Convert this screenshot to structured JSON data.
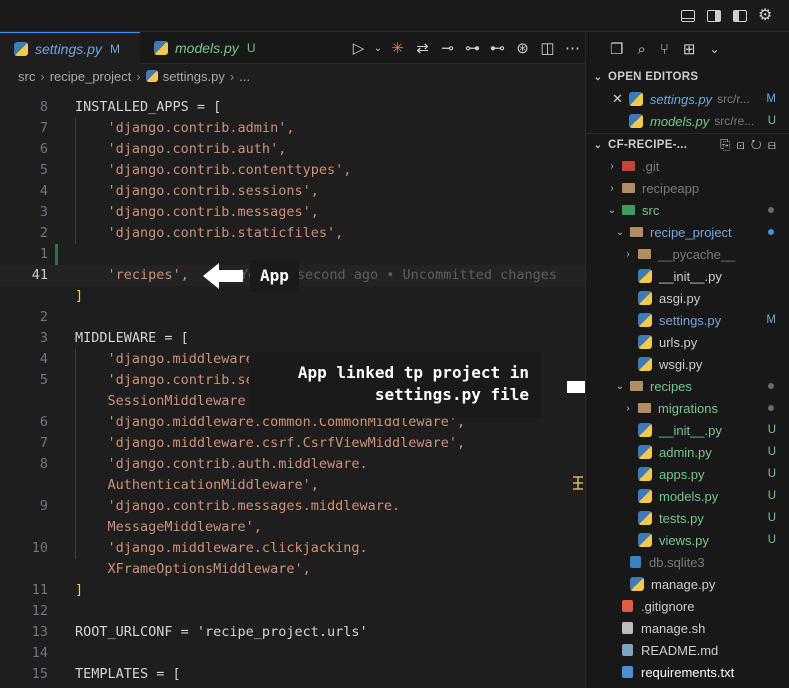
{
  "tabs": [
    {
      "label": "settings.py",
      "status": "M",
      "active": true
    },
    {
      "label": "models.py",
      "status": "U",
      "active": false
    }
  ],
  "breadcrumb": [
    "src",
    "recipe_project",
    "settings.py",
    "..."
  ],
  "code_lines": [
    {
      "num": "8",
      "text": "INSTALLED_APPS = [",
      "kind": "assign"
    },
    {
      "num": "7",
      "text": "    'django.contrib.admin',",
      "kind": "str"
    },
    {
      "num": "6",
      "text": "    'django.contrib.auth',",
      "kind": "str"
    },
    {
      "num": "5",
      "text": "    'django.contrib.contenttypes',",
      "kind": "str"
    },
    {
      "num": "4",
      "text": "    'django.contrib.sessions',",
      "kind": "str"
    },
    {
      "num": "3",
      "text": "    'django.contrib.messages',",
      "kind": "str"
    },
    {
      "num": "2",
      "text": "    'django.contrib.staticfiles',",
      "kind": "str"
    },
    {
      "num": "1",
      "text": "",
      "kind": "blank"
    },
    {
      "num": "41",
      "text": "    'recipes',",
      "kind": "str",
      "current": true,
      "blame": "You, 1 second ago • Uncommitted changes"
    },
    {
      "num": "",
      "text": "]",
      "kind": "bracket"
    },
    {
      "num": "2",
      "text": "",
      "kind": "blank"
    },
    {
      "num": "3",
      "text": "MIDDLEWARE = [",
      "kind": "assign"
    },
    {
      "num": "4",
      "text": "    'django.middleware.security.SecurityMiddleware',",
      "kind": "str"
    },
    {
      "num": "5",
      "text": "    'django.contrib.sessions.middleware.",
      "kind": "str"
    },
    {
      "num": "",
      "text": "    SessionMiddleware',",
      "kind": "str"
    },
    {
      "num": "6",
      "text": "    'django.middleware.common.CommonMiddleware',",
      "kind": "str"
    },
    {
      "num": "7",
      "text": "    'django.middleware.csrf.CsrfViewMiddleware',",
      "kind": "str"
    },
    {
      "num": "8",
      "text": "    'django.contrib.auth.middleware.",
      "kind": "str"
    },
    {
      "num": "",
      "text": "    AuthenticationMiddleware',",
      "kind": "str"
    },
    {
      "num": "9",
      "text": "    'django.contrib.messages.middleware.",
      "kind": "str"
    },
    {
      "num": "",
      "text": "    MessageMiddleware',",
      "kind": "str"
    },
    {
      "num": "10",
      "text": "    'django.middleware.clickjacking.",
      "kind": "str"
    },
    {
      "num": "",
      "text": "    XFrameOptionsMiddleware',",
      "kind": "str"
    },
    {
      "num": "11",
      "text": "]",
      "kind": "bracket"
    },
    {
      "num": "12",
      "text": "",
      "kind": "blank"
    },
    {
      "num": "13",
      "text": "ROOT_URLCONF = 'recipe_project.urls'",
      "kind": "assign"
    },
    {
      "num": "14",
      "text": "",
      "kind": "blank"
    },
    {
      "num": "15",
      "text": "TEMPLATES = [",
      "kind": "assign"
    }
  ],
  "annotations": {
    "app": "App",
    "linked_line1": "App linked tp project in",
    "linked_line2": "settings.py file"
  },
  "sidebar": {
    "open_editors_title": "OPEN EDITORS",
    "open_editors": [
      {
        "name": "settings.py",
        "path": "src/r...",
        "status": "M",
        "closable": true
      },
      {
        "name": "models.py",
        "path": "src/re...",
        "status": "U",
        "closable": false
      }
    ],
    "project_title": "CF-RECIPE-...",
    "tree": [
      {
        "name": ".git",
        "indent": 0,
        "type": "folder",
        "chev": "›",
        "style": "dim",
        "icon": "git"
      },
      {
        "name": "recipeapp",
        "indent": 0,
        "type": "folder",
        "chev": "›",
        "style": "dim"
      },
      {
        "name": "src",
        "indent": 0,
        "type": "folder",
        "chev": "⌄",
        "style": "unt",
        "marker": "dot-grey",
        "icon": "src"
      },
      {
        "name": "recipe_project",
        "indent": 1,
        "type": "folder",
        "chev": "⌄",
        "style": "mod",
        "marker": "dot-blue"
      },
      {
        "name": "__pycache__",
        "indent": 2,
        "type": "folder",
        "chev": "›",
        "style": "dim"
      },
      {
        "name": "__init__.py",
        "indent": 2,
        "type": "py",
        "style": "plain"
      },
      {
        "name": "asgi.py",
        "indent": 2,
        "type": "py",
        "style": "plain"
      },
      {
        "name": "settings.py",
        "indent": 2,
        "type": "py",
        "style": "mod",
        "badge": "M"
      },
      {
        "name": "urls.py",
        "indent": 2,
        "type": "py",
        "style": "plain"
      },
      {
        "name": "wsgi.py",
        "indent": 2,
        "type": "py",
        "style": "plain"
      },
      {
        "name": "recipes",
        "indent": 1,
        "type": "folder",
        "chev": "⌄",
        "style": "unt",
        "marker": "dot-grey"
      },
      {
        "name": "migrations",
        "indent": 2,
        "type": "folder",
        "chev": "›",
        "style": "unt",
        "marker": "dot-grey"
      },
      {
        "name": "__init__.py",
        "indent": 2,
        "type": "py",
        "style": "unt",
        "badge": "U"
      },
      {
        "name": "admin.py",
        "indent": 2,
        "type": "py",
        "style": "unt",
        "badge": "U"
      },
      {
        "name": "apps.py",
        "indent": 2,
        "type": "py",
        "style": "unt",
        "badge": "U"
      },
      {
        "name": "models.py",
        "indent": 2,
        "type": "py",
        "style": "unt",
        "badge": "U"
      },
      {
        "name": "tests.py",
        "indent": 2,
        "type": "py",
        "style": "unt",
        "badge": "U"
      },
      {
        "name": "views.py",
        "indent": 2,
        "type": "py",
        "style": "unt",
        "badge": "U"
      },
      {
        "name": "db.sqlite3",
        "indent": 1,
        "type": "db",
        "style": "dim"
      },
      {
        "name": "manage.py",
        "indent": 1,
        "type": "py",
        "style": "plain"
      },
      {
        "name": ".gitignore",
        "indent": 0,
        "type": "git",
        "style": "plain"
      },
      {
        "name": "manage.sh",
        "indent": 0,
        "type": "sh",
        "style": "plain"
      },
      {
        "name": "README.md",
        "indent": 0,
        "type": "md",
        "style": "plain"
      },
      {
        "name": "requirements.txt",
        "indent": 0,
        "type": "txt",
        "style": "bright"
      }
    ]
  }
}
